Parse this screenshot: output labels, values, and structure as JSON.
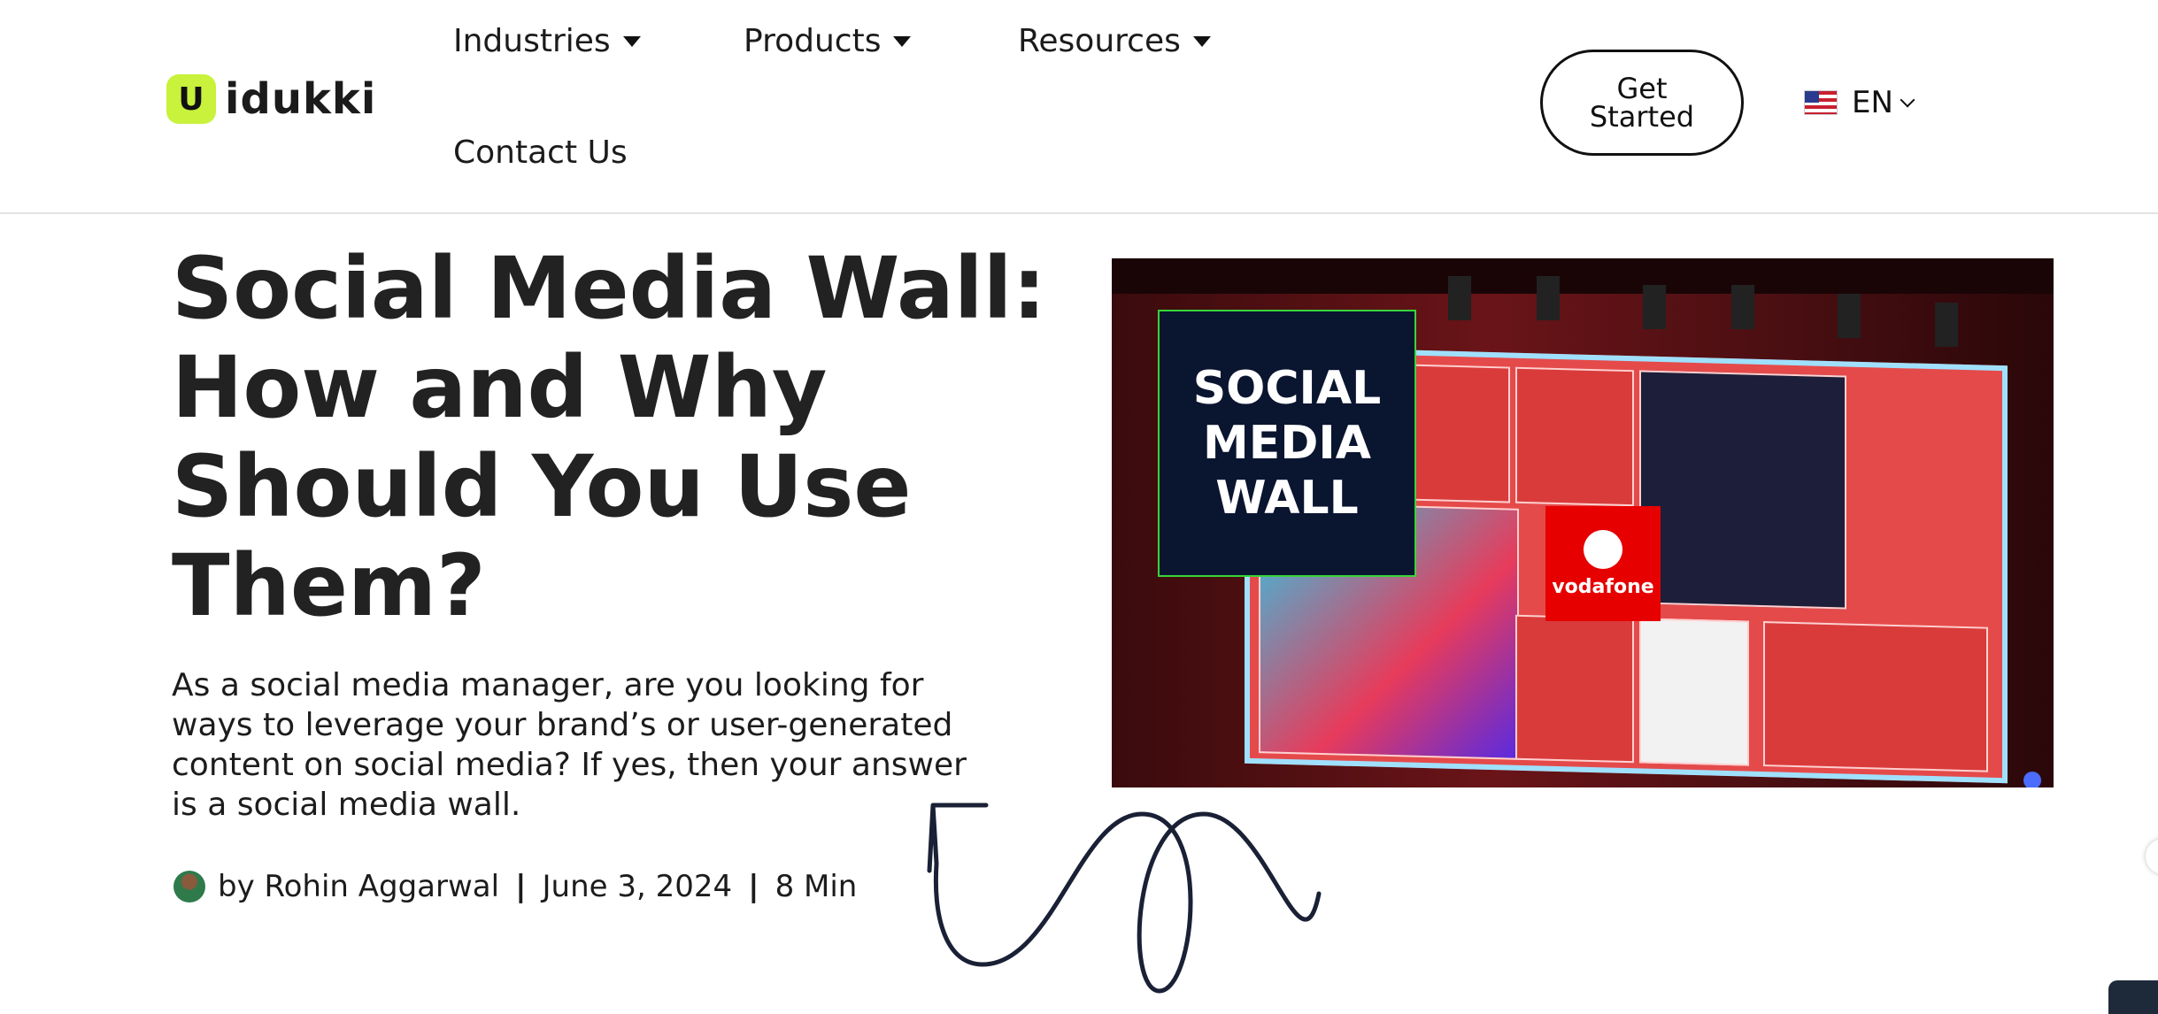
{
  "brand": {
    "badge": "U",
    "name": "idukki",
    "accent": "#c8f23b"
  },
  "nav": {
    "industries": "Industries",
    "products": "Products",
    "resources": "Resources",
    "contact": "Contact Us"
  },
  "cta": {
    "get_started_line1": "Get",
    "get_started_line2": "Started"
  },
  "language": {
    "code": "EN",
    "flag_icon": "us-flag-icon"
  },
  "article": {
    "title": "Social Media Wall: How and Why Should You Use Them?",
    "intro": "As a social media manager, are you looking for ways to leverage your brand’s or user-generated content on social media? If yes, then your answer is a social media wall.",
    "author": "by Rohin Aggarwal",
    "date": "June 3, 2024",
    "read_time": "8 Min",
    "separator": "|"
  },
  "hero_image": {
    "overlay_text": "SOCIAL MEDIA WALL",
    "vodafone": "vodafone"
  }
}
